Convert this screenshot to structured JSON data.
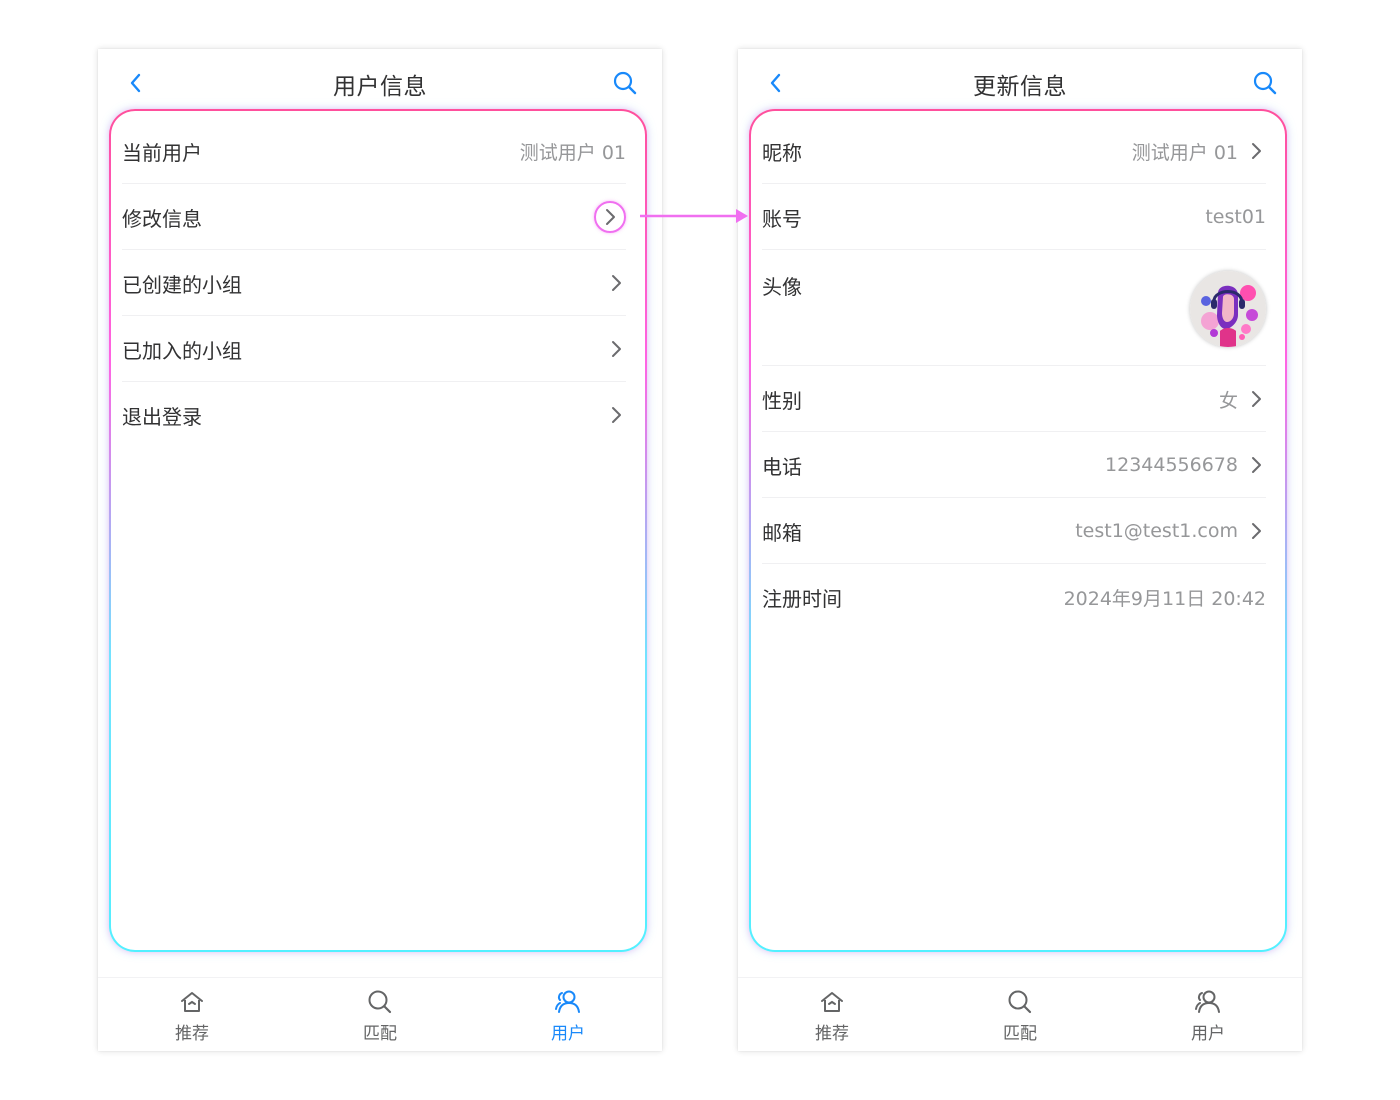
{
  "left_screen": {
    "title": "用户信息",
    "cells": [
      {
        "label": "当前用户",
        "value": "测试用户 01"
      },
      {
        "label": "修改信息"
      },
      {
        "label": "已创建的小组"
      },
      {
        "label": "已加入的小组"
      },
      {
        "label": "退出登录"
      }
    ],
    "tabs": [
      {
        "label": "推荐",
        "icon": "home-icon",
        "active": false
      },
      {
        "label": "匹配",
        "icon": "search-icon",
        "active": false
      },
      {
        "label": "用户",
        "icon": "user-icon",
        "active": true
      }
    ]
  },
  "right_screen": {
    "title": "更新信息",
    "cells": [
      {
        "label": "昵称",
        "value": "测试用户 01"
      },
      {
        "label": "账号",
        "value": "test01"
      },
      {
        "label": "头像"
      },
      {
        "label": "性别",
        "value": "女"
      },
      {
        "label": "电话",
        "value": "12344556678"
      },
      {
        "label": "邮箱",
        "value": "test1@test1.com"
      },
      {
        "label": "注册时间",
        "value": "2024年9月11日 20:42"
      }
    ],
    "tabs": [
      {
        "label": "推荐",
        "icon": "home-icon",
        "active": false
      },
      {
        "label": "匹配",
        "icon": "search-icon",
        "active": false
      },
      {
        "label": "用户",
        "icon": "user-icon",
        "active": false
      }
    ]
  },
  "colors": {
    "accent": "#1989fa",
    "neon_pink": "#ff4f9c",
    "neon_magenta": "#ff63e3",
    "neon_cyan": "#52f0ff",
    "connector": "#f06ff0",
    "text": "#323233",
    "muted": "#969799"
  }
}
